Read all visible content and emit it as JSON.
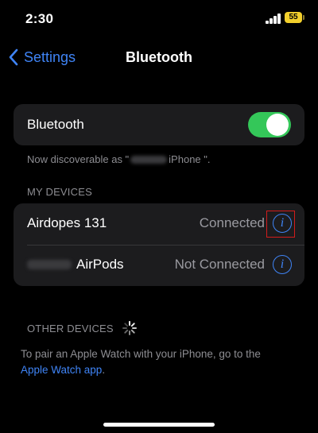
{
  "status_bar": {
    "time": "2:30",
    "battery_level": "55",
    "battery_color": "#f2cf2c"
  },
  "nav": {
    "back_label": "Settings",
    "title": "Bluetooth"
  },
  "bluetooth_toggle": {
    "label": "Bluetooth",
    "state": "on",
    "on_color": "#34c759"
  },
  "discoverable": {
    "prefix": "Now discoverable as \"",
    "suffix": " iPhone \"."
  },
  "my_devices": {
    "header": "MY DEVICES",
    "items": [
      {
        "name": "Airdopes 131",
        "status": "Connected",
        "info_icon": "info-circle-icon"
      },
      {
        "name": "AirPods",
        "status": "Not Connected",
        "info_icon": "info-circle-icon"
      }
    ]
  },
  "other_devices": {
    "header": "OTHER DEVICES",
    "pair_text": "To pair an Apple Watch with your iPhone, go to the",
    "link_text": "Apple Watch app",
    "link_suffix": "."
  },
  "colors": {
    "accent": "#3f84f6",
    "highlight": "#d21c1c",
    "background": "#000000",
    "card": "#1c1c1e"
  }
}
